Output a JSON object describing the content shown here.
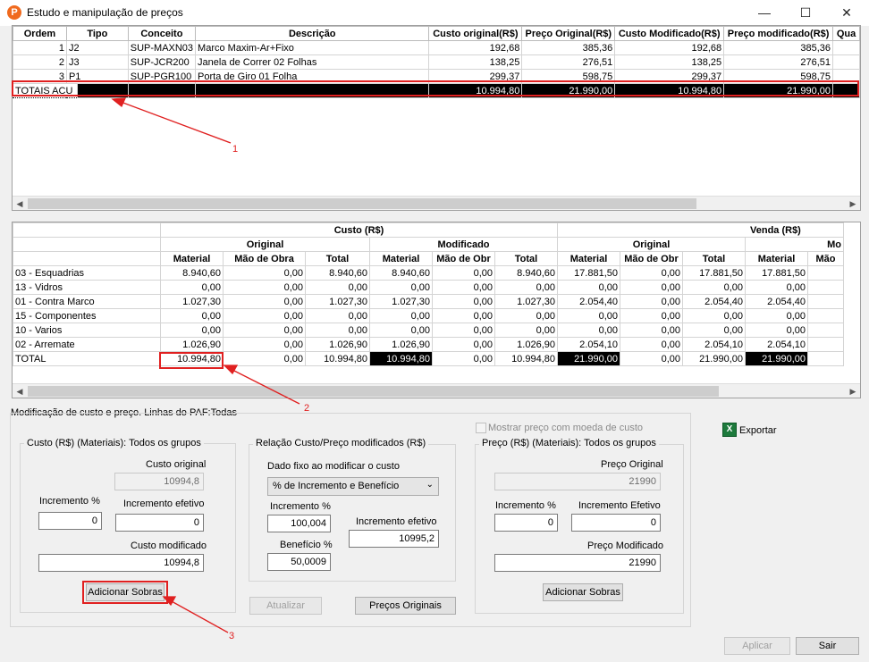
{
  "window": {
    "title": "Estudo e manipulação de preços",
    "icon_letter": "P",
    "minimize": "—",
    "maximize": "☐",
    "close": "✕"
  },
  "grid1": {
    "headers": [
      "Ordem",
      "Tipo",
      "Conceito",
      "Descrição",
      "Custo original(R$)",
      "Preço Original(R$)",
      "Custo Modificado(R$)",
      "Preço modificado(R$)",
      "Qua"
    ],
    "rows": [
      [
        "1",
        "J2",
        "SUP-MAXN03",
        "Marco Maxim-Ar+Fixo",
        "192,68",
        "385,36",
        "192,68",
        "385,36",
        ""
      ],
      [
        "2",
        "J3",
        "SUP-JCR200",
        "Janela de Correr 02 Folhas",
        "138,25",
        "276,51",
        "138,25",
        "276,51",
        ""
      ],
      [
        "3",
        "P1",
        "SUP-PGR100",
        "Porta de Giro 01 Folha",
        "299,37",
        "598,75",
        "299,37",
        "598,75",
        ""
      ]
    ],
    "totals": [
      "TOTAIS ACU",
      "",
      "",
      "",
      "10.994,80",
      "21.990,00",
      "10.994,80",
      "21.990,00",
      ""
    ]
  },
  "grid2": {
    "group_custo": "Custo (R$)",
    "group_venda": "Venda (R$)",
    "sub_original": "Original",
    "sub_modificado": "Modificado",
    "sub_original2": "Original",
    "sub_mod2": "Mo",
    "cols": [
      "Material",
      "Mão de Obra",
      "Total",
      "Material",
      "Mão de Obr",
      "Total",
      "Material",
      "Mão de Obr",
      "Total",
      "Material",
      "Mão"
    ],
    "rows": [
      [
        "03 - Esquadrias",
        "8.940,60",
        "0,00",
        "8.940,60",
        "8.940,60",
        "0,00",
        "8.940,60",
        "17.881,50",
        "0,00",
        "17.881,50",
        "17.881,50",
        ""
      ],
      [
        "13 - Vidros",
        "0,00",
        "0,00",
        "0,00",
        "0,00",
        "0,00",
        "0,00",
        "0,00",
        "0,00",
        "0,00",
        "0,00",
        ""
      ],
      [
        "01 - Contra Marco",
        "1.027,30",
        "0,00",
        "1.027,30",
        "1.027,30",
        "0,00",
        "1.027,30",
        "2.054,40",
        "0,00",
        "2.054,40",
        "2.054,40",
        ""
      ],
      [
        "15 - Componentes",
        "0,00",
        "0,00",
        "0,00",
        "0,00",
        "0,00",
        "0,00",
        "0,00",
        "0,00",
        "0,00",
        "0,00",
        ""
      ],
      [
        "10 - Varios",
        "0,00",
        "0,00",
        "0,00",
        "0,00",
        "0,00",
        "0,00",
        "0,00",
        "0,00",
        "0,00",
        "0,00",
        ""
      ],
      [
        "02 - Arremate",
        "1.026,90",
        "0,00",
        "1.026,90",
        "1.026,90",
        "0,00",
        "1.026,90",
        "2.054,10",
        "0,00",
        "2.054,10",
        "2.054,10",
        ""
      ]
    ],
    "total": [
      "TOTAL",
      "10.994,80",
      "0,00",
      "10.994,80",
      "10.994,80",
      "0,00",
      "10.994,80",
      "21.990,00",
      "0,00",
      "21.990,00",
      "21.990,00",
      ""
    ]
  },
  "panel": {
    "title": "Modificação de custo e preço. Linhas do PAF:Todas",
    "custo": {
      "title": "Custo (R$) (Materiais): Todos os grupos",
      "custo_original_label": "Custo original",
      "custo_original": "10994,8",
      "incremento_label": "Incremento %",
      "incremento": "0",
      "inc_efetivo_label": "Incremento efetivo",
      "inc_efetivo": "0",
      "custo_mod_label": "Custo modificado",
      "custo_mod": "10994,8",
      "btn_sobras": "Adicionar Sobras"
    },
    "relacao": {
      "title": "Relação Custo/Preço modificados (R$)",
      "dado_label": "Dado fixo ao modificar o custo",
      "dado_value": "% de Incremento e Benefício",
      "incremento_label": "Incremento %",
      "incremento": "100,004",
      "inc_efetivo_label": "Incremento efetivo",
      "inc_efetivo": "10995,2",
      "beneficio_label": "Benefício %",
      "beneficio": "50,0009"
    },
    "btn_atualizar": "Atualizar",
    "btn_precos_originais": "Preços Originais",
    "mostrar_label": "Mostrar preço com moeda de custo",
    "preco": {
      "title": "Preço (R$) (Materiais): Todos os grupos",
      "preco_original_label": "Preço Original",
      "preco_original": "21990",
      "incremento_label": "Incremento %",
      "incremento": "0",
      "inc_efetivo_label": "Incremento Efetivo",
      "inc_efetivo": "0",
      "preco_mod_label": "Preço Modificado",
      "preco_mod": "21990",
      "btn_sobras": "Adicionar Sobras"
    }
  },
  "exportar": "Exportar",
  "btn_aplicar": "Aplicar",
  "btn_sair": "Sair",
  "annotations": {
    "a1": "1",
    "a2": "2",
    "a3": "3"
  },
  "colors": {
    "annotation": "#e02020",
    "selection_dark": "#000000",
    "icon_orange": "#f06a1e"
  }
}
